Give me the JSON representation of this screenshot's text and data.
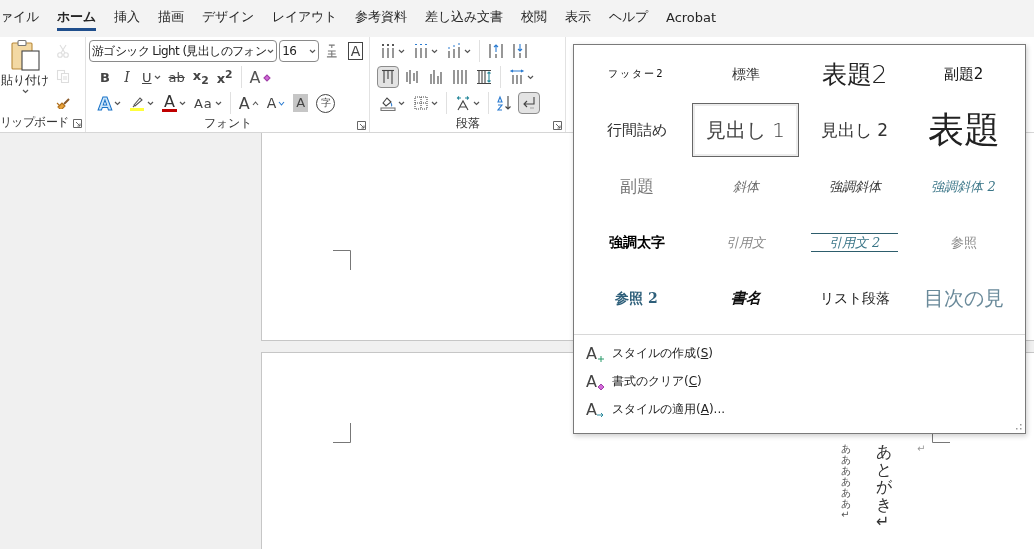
{
  "tabs": [
    {
      "label": "ァイル",
      "selected": false
    },
    {
      "label": "ホーム",
      "selected": true
    },
    {
      "label": "挿入",
      "selected": false
    },
    {
      "label": "描画",
      "selected": false
    },
    {
      "label": "デザイン",
      "selected": false
    },
    {
      "label": "レイアウト",
      "selected": false
    },
    {
      "label": "参考資料",
      "selected": false
    },
    {
      "label": "差し込み文書",
      "selected": false
    },
    {
      "label": "校閲",
      "selected": false
    },
    {
      "label": "表示",
      "selected": false
    },
    {
      "label": "ヘルプ",
      "selected": false
    },
    {
      "label": "Acrobat",
      "selected": false
    }
  ],
  "clipboard": {
    "paste_label": "貼り付け",
    "group_label": "リップボード",
    "tools": [
      {
        "kind": "cut",
        "disabled": true
      },
      {
        "kind": "copy",
        "disabled": true
      },
      {
        "kind": "format-painter",
        "disabled": false
      }
    ]
  },
  "font": {
    "font_name": "游ゴシック Light (見出しのフォン",
    "font_size": "16",
    "group_label": "フォント",
    "top_row": [
      {
        "kind": "phonetic",
        "dropdown": false
      },
      {
        "kind": "char-border",
        "label": "A",
        "dropdown": false
      }
    ],
    "middle_row": [
      {
        "kind": "bold",
        "label": "B",
        "dropdown": false
      },
      {
        "kind": "italic",
        "label": "I",
        "dropdown": false
      },
      {
        "kind": "underline",
        "label": "U",
        "dropdown": true
      },
      {
        "kind": "strike",
        "label": "ab",
        "dropdown": false
      },
      {
        "kind": "subscript",
        "label": "x$_{2}$",
        "dropdown": false
      },
      {
        "kind": "superscript",
        "label": "x$^{2}$",
        "dropdown": false
      },
      {
        "kind": "separator"
      },
      {
        "kind": "clear-format",
        "label": "A",
        "dropdown": false
      }
    ],
    "bottom_row": [
      {
        "kind": "text-effect",
        "label": "A",
        "dropdown": true
      },
      {
        "kind": "highlight",
        "dropdown": true
      },
      {
        "kind": "font-color",
        "label": "A",
        "dropdown": true
      },
      {
        "kind": "change-case",
        "label": "Aa",
        "dropdown": true
      },
      {
        "kind": "separator"
      },
      {
        "kind": "grow",
        "label": "A",
        "dropdown": false
      },
      {
        "kind": "shrink",
        "label": "A",
        "dropdown": false
      },
      {
        "kind": "shading",
        "label": "A",
        "dropdown": false
      },
      {
        "kind": "enclose",
        "label": "字",
        "dropdown": false
      }
    ]
  },
  "paragraph": {
    "group_label": "段落",
    "top_row": [
      {
        "kind": "bullets",
        "dropdown": true,
        "selected": false
      },
      {
        "kind": "numbering",
        "dropdown": true,
        "selected": false
      },
      {
        "kind": "multilevel",
        "dropdown": true,
        "selected": false
      },
      {
        "kind": "separator"
      },
      {
        "kind": "decrease-indent",
        "dropdown": false,
        "selected": false
      },
      {
        "kind": "increase-indent",
        "dropdown": false,
        "selected": false
      }
    ],
    "middle_row": [
      {
        "kind": "align-top",
        "dropdown": false,
        "selected": true
      },
      {
        "kind": "align-middle",
        "dropdown": false,
        "selected": false
      },
      {
        "kind": "align-bottom",
        "dropdown": false,
        "selected": false
      },
      {
        "kind": "justify",
        "dropdown": false,
        "selected": false
      },
      {
        "kind": "distribute",
        "dropdown": false,
        "selected": false
      },
      {
        "kind": "separator"
      },
      {
        "kind": "line-spacing",
        "dropdown": true,
        "selected": false
      }
    ],
    "bottom_row": [
      {
        "kind": "shading",
        "dropdown": true,
        "selected": false
      },
      {
        "kind": "borders",
        "dropdown": true,
        "selected": false
      },
      {
        "kind": "separator"
      },
      {
        "kind": "asian-layout",
        "dropdown": true,
        "selected": false
      },
      {
        "kind": "separator"
      },
      {
        "kind": "sort",
        "dropdown": false,
        "selected": false
      },
      {
        "kind": "show-marks",
        "dropdown": false,
        "selected": true
      }
    ]
  },
  "document": {
    "columns": [
      {
        "kind": "body",
        "text": "ああああああ↵"
      },
      {
        "kind": "heading",
        "text": "あとがき↵"
      },
      {
        "kind": "empty",
        "text": "↵"
      }
    ]
  },
  "style_gallery": {
    "rows": [
      [
        {
          "label": "フッター2",
          "kind": "footer",
          "selected": false
        },
        {
          "label": "標準",
          "kind": "normal",
          "selected": false
        },
        {
          "label": "表題2",
          "kind": "title2",
          "selected": false
        },
        {
          "label": "副題2",
          "kind": "subtitle2",
          "selected": false
        }
      ],
      [
        {
          "label": "行間詰め",
          "kind": "no-spacing",
          "selected": false
        },
        {
          "label": "見出し 1",
          "kind": "heading1",
          "selected": true
        },
        {
          "label": "見出し 2",
          "kind": "heading2",
          "selected": false
        },
        {
          "label": "表題",
          "kind": "title",
          "selected": false
        }
      ],
      [
        {
          "label": "副題",
          "kind": "subtitle",
          "selected": false
        },
        {
          "label": "斜体",
          "kind": "subtle-emphasis",
          "selected": false
        },
        {
          "label": "強調斜体",
          "kind": "emphasis",
          "selected": false
        },
        {
          "label": "強調斜体 2",
          "kind": "intense-emphasis",
          "selected": false
        }
      ],
      [
        {
          "label": "強調太字",
          "kind": "strong",
          "selected": false
        },
        {
          "label": "引用文",
          "kind": "quote",
          "selected": false
        },
        {
          "label": "引用文 2",
          "kind": "intense-quote",
          "selected": false
        },
        {
          "label": "参照",
          "kind": "subtle-reference",
          "selected": false
        }
      ],
      [
        {
          "label": "参照 2",
          "kind": "intense-reference",
          "selected": false
        },
        {
          "label": "書名",
          "kind": "book-title",
          "selected": false
        },
        {
          "label": "リスト段落",
          "kind": "list-paragraph",
          "selected": false
        },
        {
          "label": "目次の見",
          "kind": "toc-heading",
          "selected": false
        }
      ]
    ],
    "menu": [
      {
        "kind": "new-style",
        "glyph": "A",
        "text": "スタイルの作成(",
        "key": "S",
        "tail": ")"
      },
      {
        "kind": "clear",
        "glyph": "A",
        "text": "書式のクリア(",
        "key": "C",
        "tail": ")"
      },
      {
        "kind": "apply",
        "glyph": "A",
        "text": "スタイルの適用(",
        "key": "A",
        "tail": ")..."
      }
    ]
  }
}
